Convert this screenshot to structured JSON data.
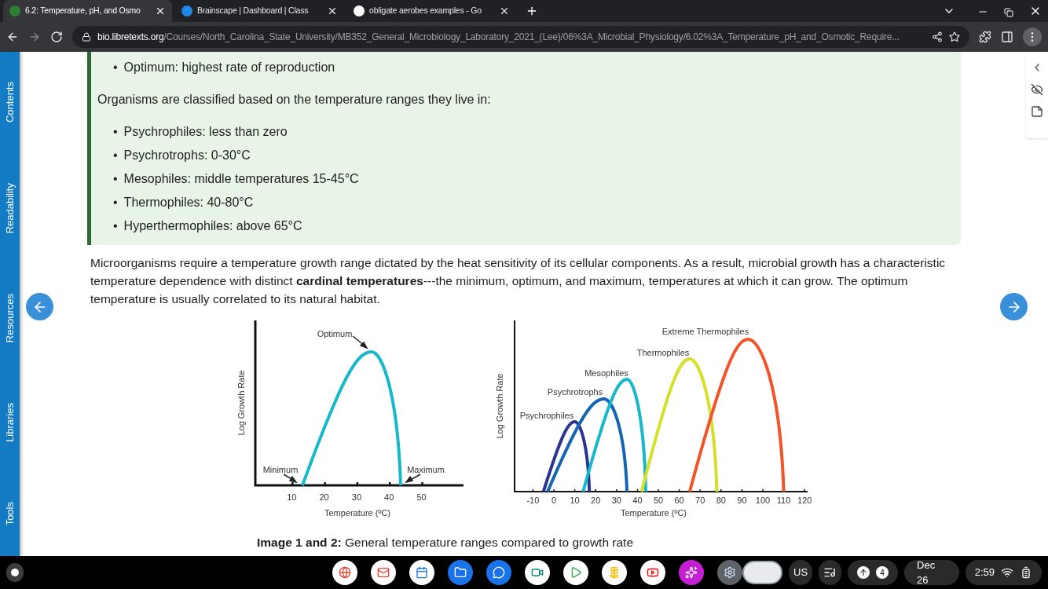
{
  "browser": {
    "tabs": [
      {
        "title": "6.2: Temperature, pH, and Osmo",
        "selected": true
      },
      {
        "title": "Brainscape | Dashboard | Class",
        "selected": false
      },
      {
        "title": "obligate aerobes examples - Go",
        "selected": false
      }
    ],
    "url": {
      "host": "bio.libretexts.org",
      "path": "/Courses/North_Carolina_State_University/MB352_General_Microbiology_Laboratory_2021_(Lee)/06%3A_Microbial_Physiology/6.02%3A_Temperature_pH_and_Osmotic_Require..."
    }
  },
  "side_tabs": [
    "Contents",
    "Readability",
    "Resources",
    "Libraries",
    "Tools"
  ],
  "content": {
    "callout": {
      "bullets_top": [
        "Optimum: highest rate of reproduction"
      ],
      "marker": "•",
      "intro": "Organisms are classified based on the temperature ranges they live in:",
      "bullets": [
        "Psychrophiles: less than zero",
        "Psychrotrophs: 0-30°C",
        "Mesophiles: middle temperatures 15-45°C",
        "Thermophiles: 40-80°C",
        "Hyperthermophiles: above 65°C"
      ]
    },
    "paragraph": "Microorganisms require a temperature growth range dictated by the heat sensitivity of its cellular components.  As a result, microbial growth has a characteristic temperature dependence with distinct **cardinal temperatures**---the minimum, optimum, and maximum, temperatures at which it can grow.  The optimum temperature is usually correlated to its natural habitat.",
    "figure1": {
      "ylabel": "Log Growth Rate",
      "xlabel": "Temperature (ºC)",
      "xticks": [
        "10",
        "20",
        "30",
        "40",
        "50"
      ],
      "annotations": [
        "Optimum",
        "Minimum",
        "Maximum"
      ]
    },
    "figure2": {
      "ylabel": "Log Growth Rate",
      "xlabel": "Temperature (ºC)",
      "xticks": [
        "-10",
        "0",
        "10",
        "20",
        "30",
        "40",
        "50",
        "60",
        "70",
        "80",
        "90",
        "100",
        "110",
        "120"
      ],
      "curves": [
        {
          "label": "Psychrophiles",
          "color": "#2b3590"
        },
        {
          "label": "Psychrotrophs",
          "color": "#1565b0"
        },
        {
          "label": "Mesophiles",
          "color": "#17b8c8"
        },
        {
          "label": "Thermophiles",
          "color": "#d4e02a"
        },
        {
          "label": "Extreme Thermophiles",
          "color": "#f2542a"
        }
      ]
    },
    "caption": "**Image 1 and 2:** General temperature ranges compared to growth rate"
  },
  "taskbar": {
    "keyboard": "US",
    "badge": "4",
    "date": "Dec 26",
    "time": "2:59"
  }
}
